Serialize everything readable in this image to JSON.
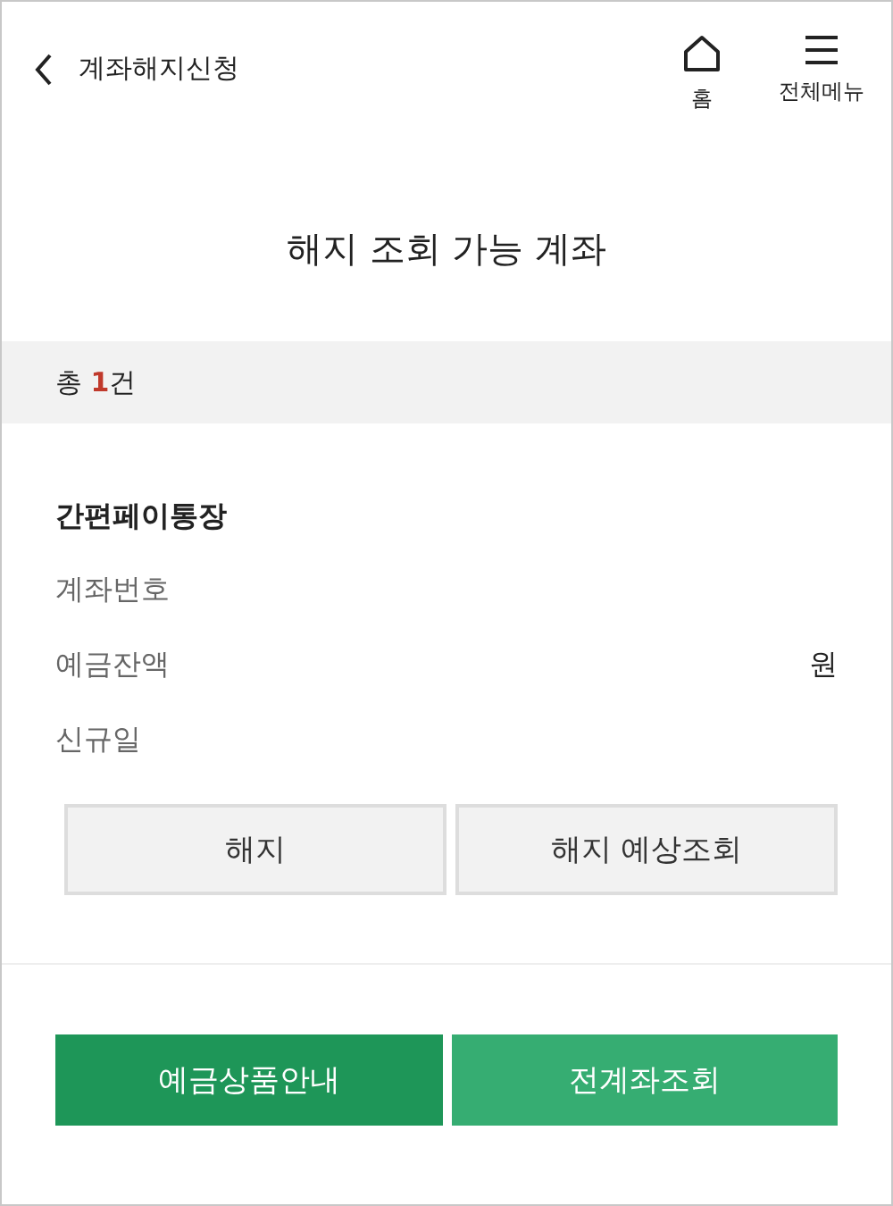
{
  "header": {
    "title": "계좌해지신청",
    "nav": [
      {
        "kind": "home",
        "label": "홈"
      },
      {
        "kind": "menu",
        "label": "전체메뉴"
      }
    ]
  },
  "page_title": "해지 조회 가능 계좌",
  "count": {
    "prefix": "총",
    "number": "1",
    "suffix": "건"
  },
  "account": {
    "name": "간편페이통장",
    "fields": [
      {
        "label": "계좌번호"
      },
      {
        "label": "예금잔액",
        "value": "원"
      },
      {
        "label": "신규일"
      }
    ],
    "actions": [
      "해지",
      "해지 예상조회"
    ]
  },
  "footer_buttons": [
    {
      "label": "예금상품안내",
      "kind": "primary"
    },
    {
      "label": "전계좌조회",
      "kind": "secondary"
    }
  ]
}
